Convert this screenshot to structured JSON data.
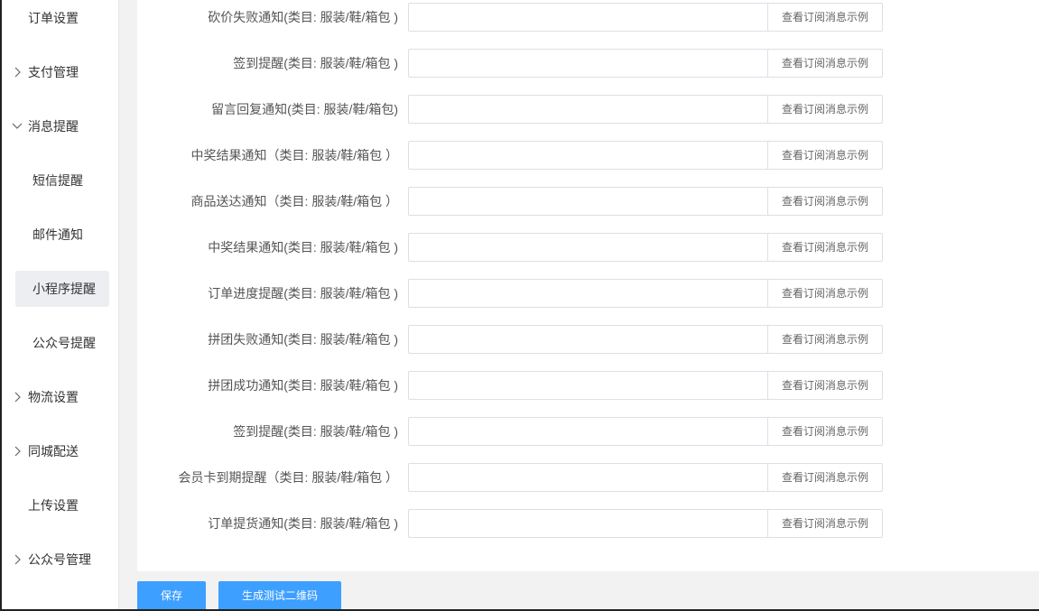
{
  "sidebar": {
    "items": [
      {
        "label": "订单设置",
        "chevron": "none"
      },
      {
        "label": "支付管理",
        "chevron": "right"
      },
      {
        "label": "消息提醒",
        "chevron": "down"
      },
      {
        "label": "短信提醒",
        "chevron": "none"
      },
      {
        "label": "邮件通知",
        "chevron": "none"
      },
      {
        "label": "小程序提醒",
        "chevron": "none",
        "active": true
      },
      {
        "label": "公众号提醒",
        "chevron": "none"
      },
      {
        "label": "物流设置",
        "chevron": "right"
      },
      {
        "label": "同城配送",
        "chevron": "right"
      },
      {
        "label": "上传设置",
        "chevron": "none"
      },
      {
        "label": "公众号管理",
        "chevron": "right"
      }
    ]
  },
  "rows": [
    {
      "label": "砍价失败通知(类目: 服装/鞋/箱包 )",
      "value": "",
      "button": "查看订阅消息示例"
    },
    {
      "label": "签到提醒(类目: 服装/鞋/箱包 )",
      "value": "",
      "button": "查看订阅消息示例"
    },
    {
      "label": "留言回复通知(类目: 服装/鞋/箱包)",
      "value": "",
      "button": "查看订阅消息示例"
    },
    {
      "label": "中奖结果通知（类目: 服装/鞋/箱包 ）",
      "value": "",
      "button": "查看订阅消息示例"
    },
    {
      "label": "商品送达通知（类目: 服装/鞋/箱包 ）",
      "value": "",
      "button": "查看订阅消息示例"
    },
    {
      "label": "中奖结果通知(类目: 服装/鞋/箱包 )",
      "value": "",
      "button": "查看订阅消息示例"
    },
    {
      "label": "订单进度提醒(类目: 服装/鞋/箱包 )",
      "value": "",
      "button": "查看订阅消息示例"
    },
    {
      "label": "拼团失败通知(类目: 服装/鞋/箱包 )",
      "value": "",
      "button": "查看订阅消息示例"
    },
    {
      "label": "拼团成功通知(类目: 服装/鞋/箱包 )",
      "value": "",
      "button": "查看订阅消息示例"
    },
    {
      "label": "签到提醒(类目: 服装/鞋/箱包 )",
      "value": "",
      "button": "查看订阅消息示例"
    },
    {
      "label": "会员卡到期提醒（类目: 服装/鞋/箱包 ）",
      "value": "",
      "button": "查看订阅消息示例"
    },
    {
      "label": "订单提货通知(类目: 服装/鞋/箱包 )",
      "value": "",
      "button": "查看订阅消息示例"
    }
  ],
  "footer": {
    "save_label": "保存",
    "qr_label": "生成测试二维码"
  },
  "colors": {
    "primary": "#3d9fff",
    "active_bg": "#eceef1",
    "border": "#dcdfe6"
  }
}
